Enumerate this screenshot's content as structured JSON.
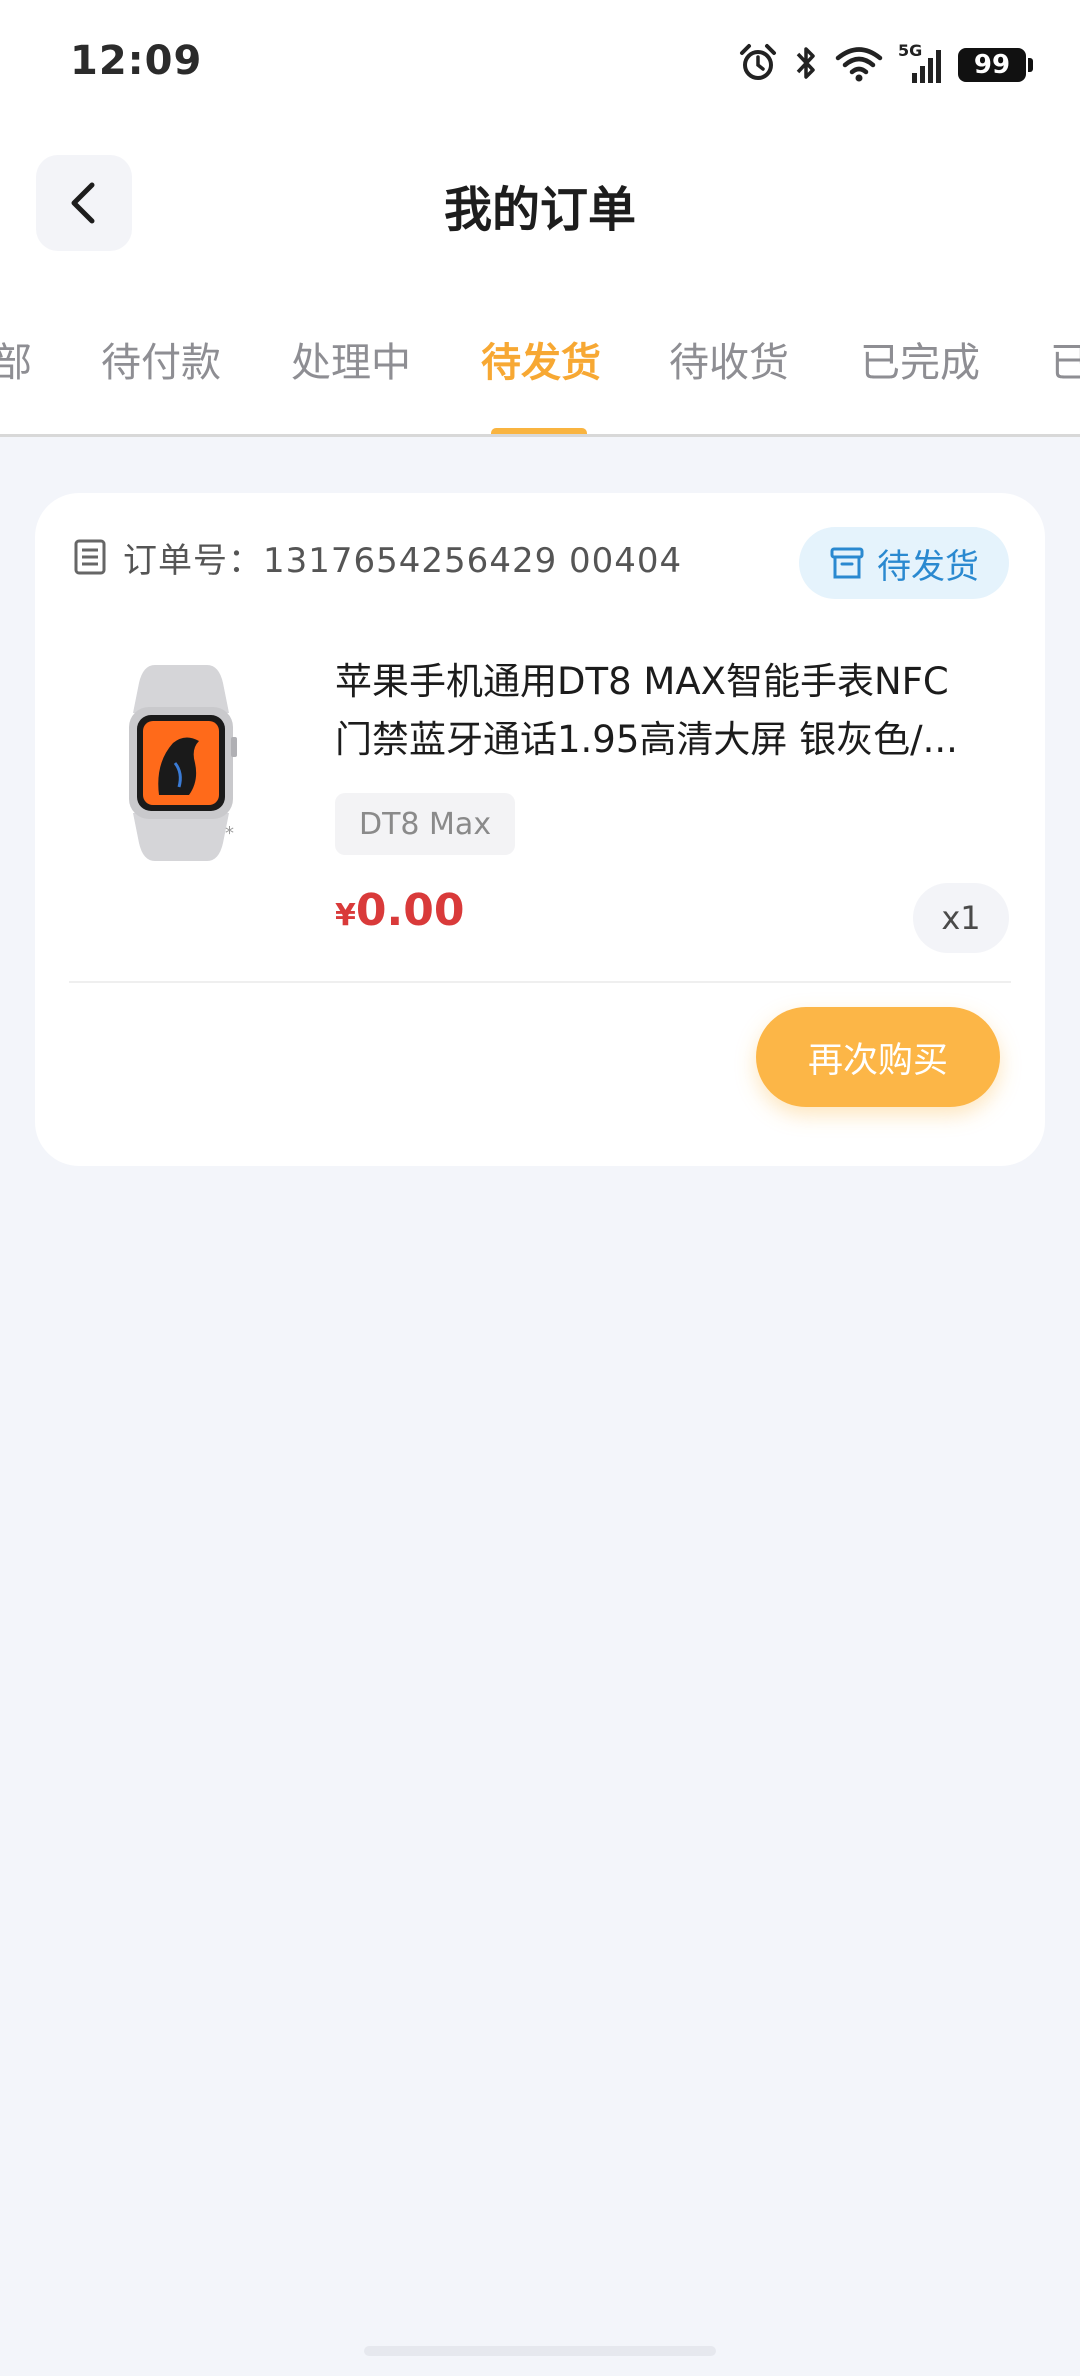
{
  "status_bar": {
    "time": "12:09",
    "network": "5G",
    "battery": "99",
    "icons": [
      "alarm-icon",
      "bluetooth-icon",
      "wifi-icon",
      "signal-icon",
      "battery-icon"
    ]
  },
  "header": {
    "back_icon": "chevron-left-icon",
    "title": "我的订单"
  },
  "tabs": [
    {
      "label": "部",
      "active": false
    },
    {
      "label": "待付款",
      "active": false
    },
    {
      "label": "处理中",
      "active": false
    },
    {
      "label": "待发货",
      "active": true
    },
    {
      "label": "待收货",
      "active": false
    },
    {
      "label": "已完成",
      "active": false
    },
    {
      "label": "已",
      "active": false
    }
  ],
  "order": {
    "order_no_label": "订单号：1317654256429 00404",
    "status": "待发货",
    "product": {
      "title_line1": "苹果手机通用DT8 MAX智能手表NFC",
      "title_line2": "门禁蓝牙通话1.95高清大屏 银灰色/...",
      "spec": "DT8 Max",
      "currency": "¥",
      "price": "0.00",
      "quantity": "x1"
    },
    "rebuy_label": "再次购买"
  },
  "colors": {
    "accent": "#f7a833",
    "button": "#fcb647",
    "price": "#d93a3a",
    "status_blue": "#2a89d0",
    "background": "#f3f5fa"
  }
}
